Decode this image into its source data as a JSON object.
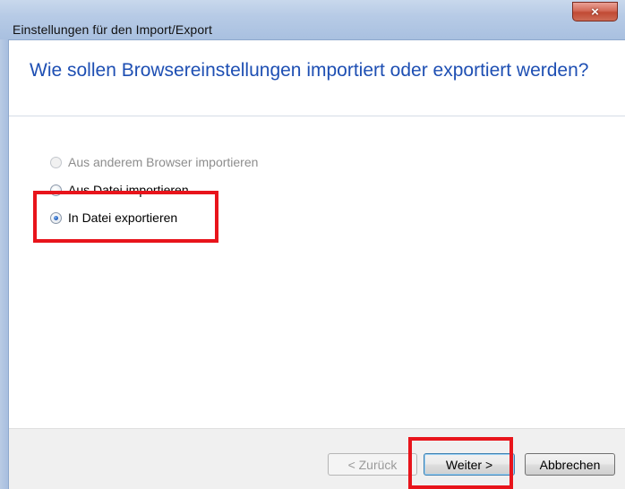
{
  "window": {
    "title": "Einstellungen für den Import/Export",
    "close_icon": "×"
  },
  "header": {
    "heading": "Wie sollen Browsereinstellungen importiert oder exportiert werden?"
  },
  "options": [
    {
      "label": "Aus anderem Browser importieren",
      "enabled": false,
      "checked": false
    },
    {
      "label": "Aus Datei importieren",
      "enabled": true,
      "checked": false
    },
    {
      "label": "In Datei exportieren",
      "enabled": true,
      "checked": true
    }
  ],
  "buttons": {
    "back": "< Zurück",
    "next": "Weiter >",
    "cancel": "Abbrechen"
  },
  "colors": {
    "heading": "#1e4fb3",
    "highlight": "#e8141b"
  }
}
